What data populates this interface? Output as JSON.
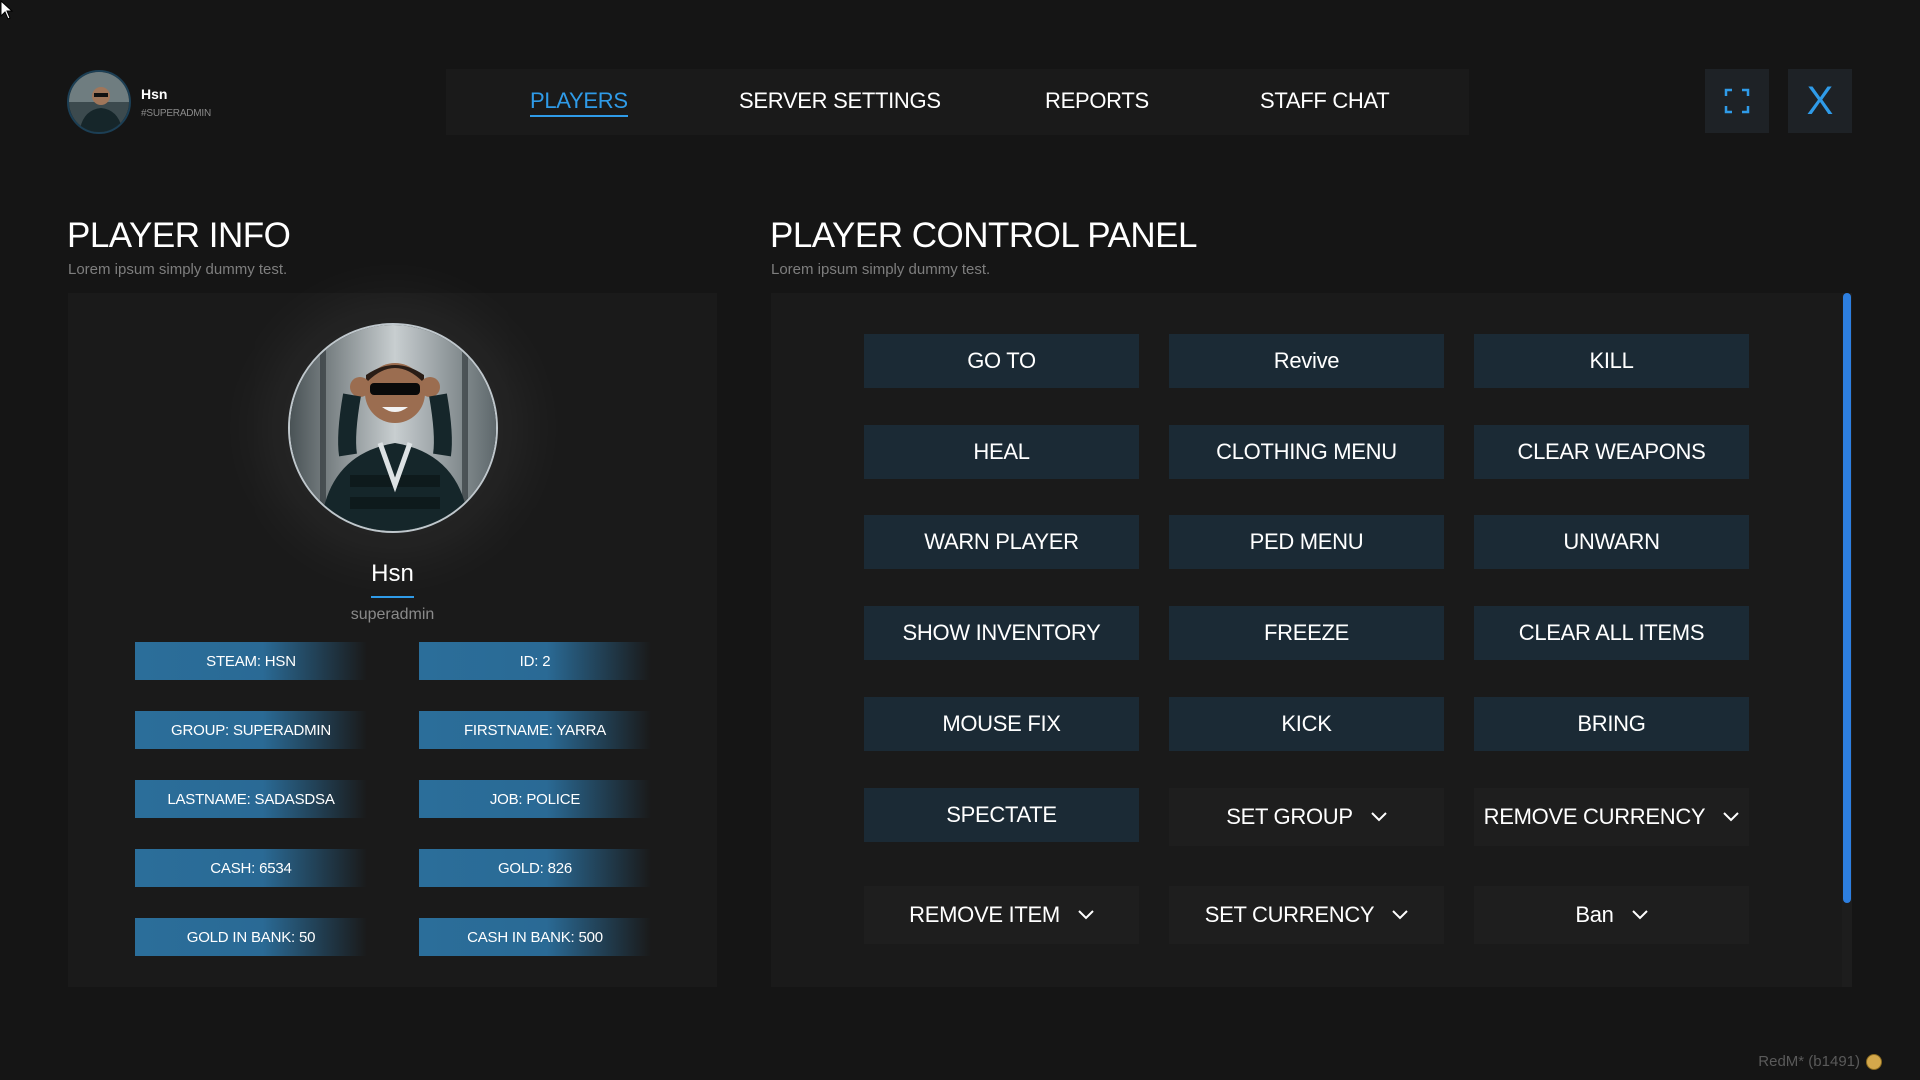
{
  "header": {
    "user_name": "Hsn",
    "user_role": "#SUPERADMIN",
    "tabs": [
      {
        "label": "PLAYERS",
        "active": true
      },
      {
        "label": "SERVER SETTINGS",
        "active": false
      },
      {
        "label": "REPORTS",
        "active": false
      },
      {
        "label": "STAFF CHAT",
        "active": false
      }
    ],
    "close_label": "X"
  },
  "player_info": {
    "title": "PLAYER INFO",
    "subtitle": "Lorem ipsum simply dummy test.",
    "name": "Hsn",
    "rank": "superadmin",
    "stats": [
      "STEAM: HSN",
      "ID: 2",
      "GROUP: SUPERADMIN",
      "FIRSTNAME: YARRA",
      "LASTNAME: SADASDSA",
      "JOB: POLICE",
      "CASH: 6534",
      "GOLD: 826",
      "GOLD IN BANK:  50",
      "CASH IN BANK:  500"
    ]
  },
  "control_panel": {
    "title": "PLAYER CONTROL PANEL",
    "subtitle": "Lorem ipsum simply dummy test.",
    "actions": [
      "GO TO",
      "Revive",
      "KILL",
      "HEAL",
      "CLOTHING MENU",
      "CLEAR WEAPONS",
      "WARN PLAYER",
      "PED MENU",
      "UNWARN",
      "SHOW INVENTORY",
      "FREEZE",
      "CLEAR ALL ITEMS",
      "MOUSE FIX",
      "KICK",
      "BRING",
      "SPECTATE"
    ],
    "dropdowns": [
      "SET GROUP",
      "REMOVE CURRENCY",
      "REMOVE ITEM",
      "SET CURRENCY",
      "Ban"
    ]
  },
  "footer": {
    "version": "RedM* (b1491)"
  },
  "colors": {
    "accent": "#2f9be8",
    "button_bg": "#1b2a35",
    "stat_bg": "#2b6e9a",
    "background": "#151515"
  }
}
